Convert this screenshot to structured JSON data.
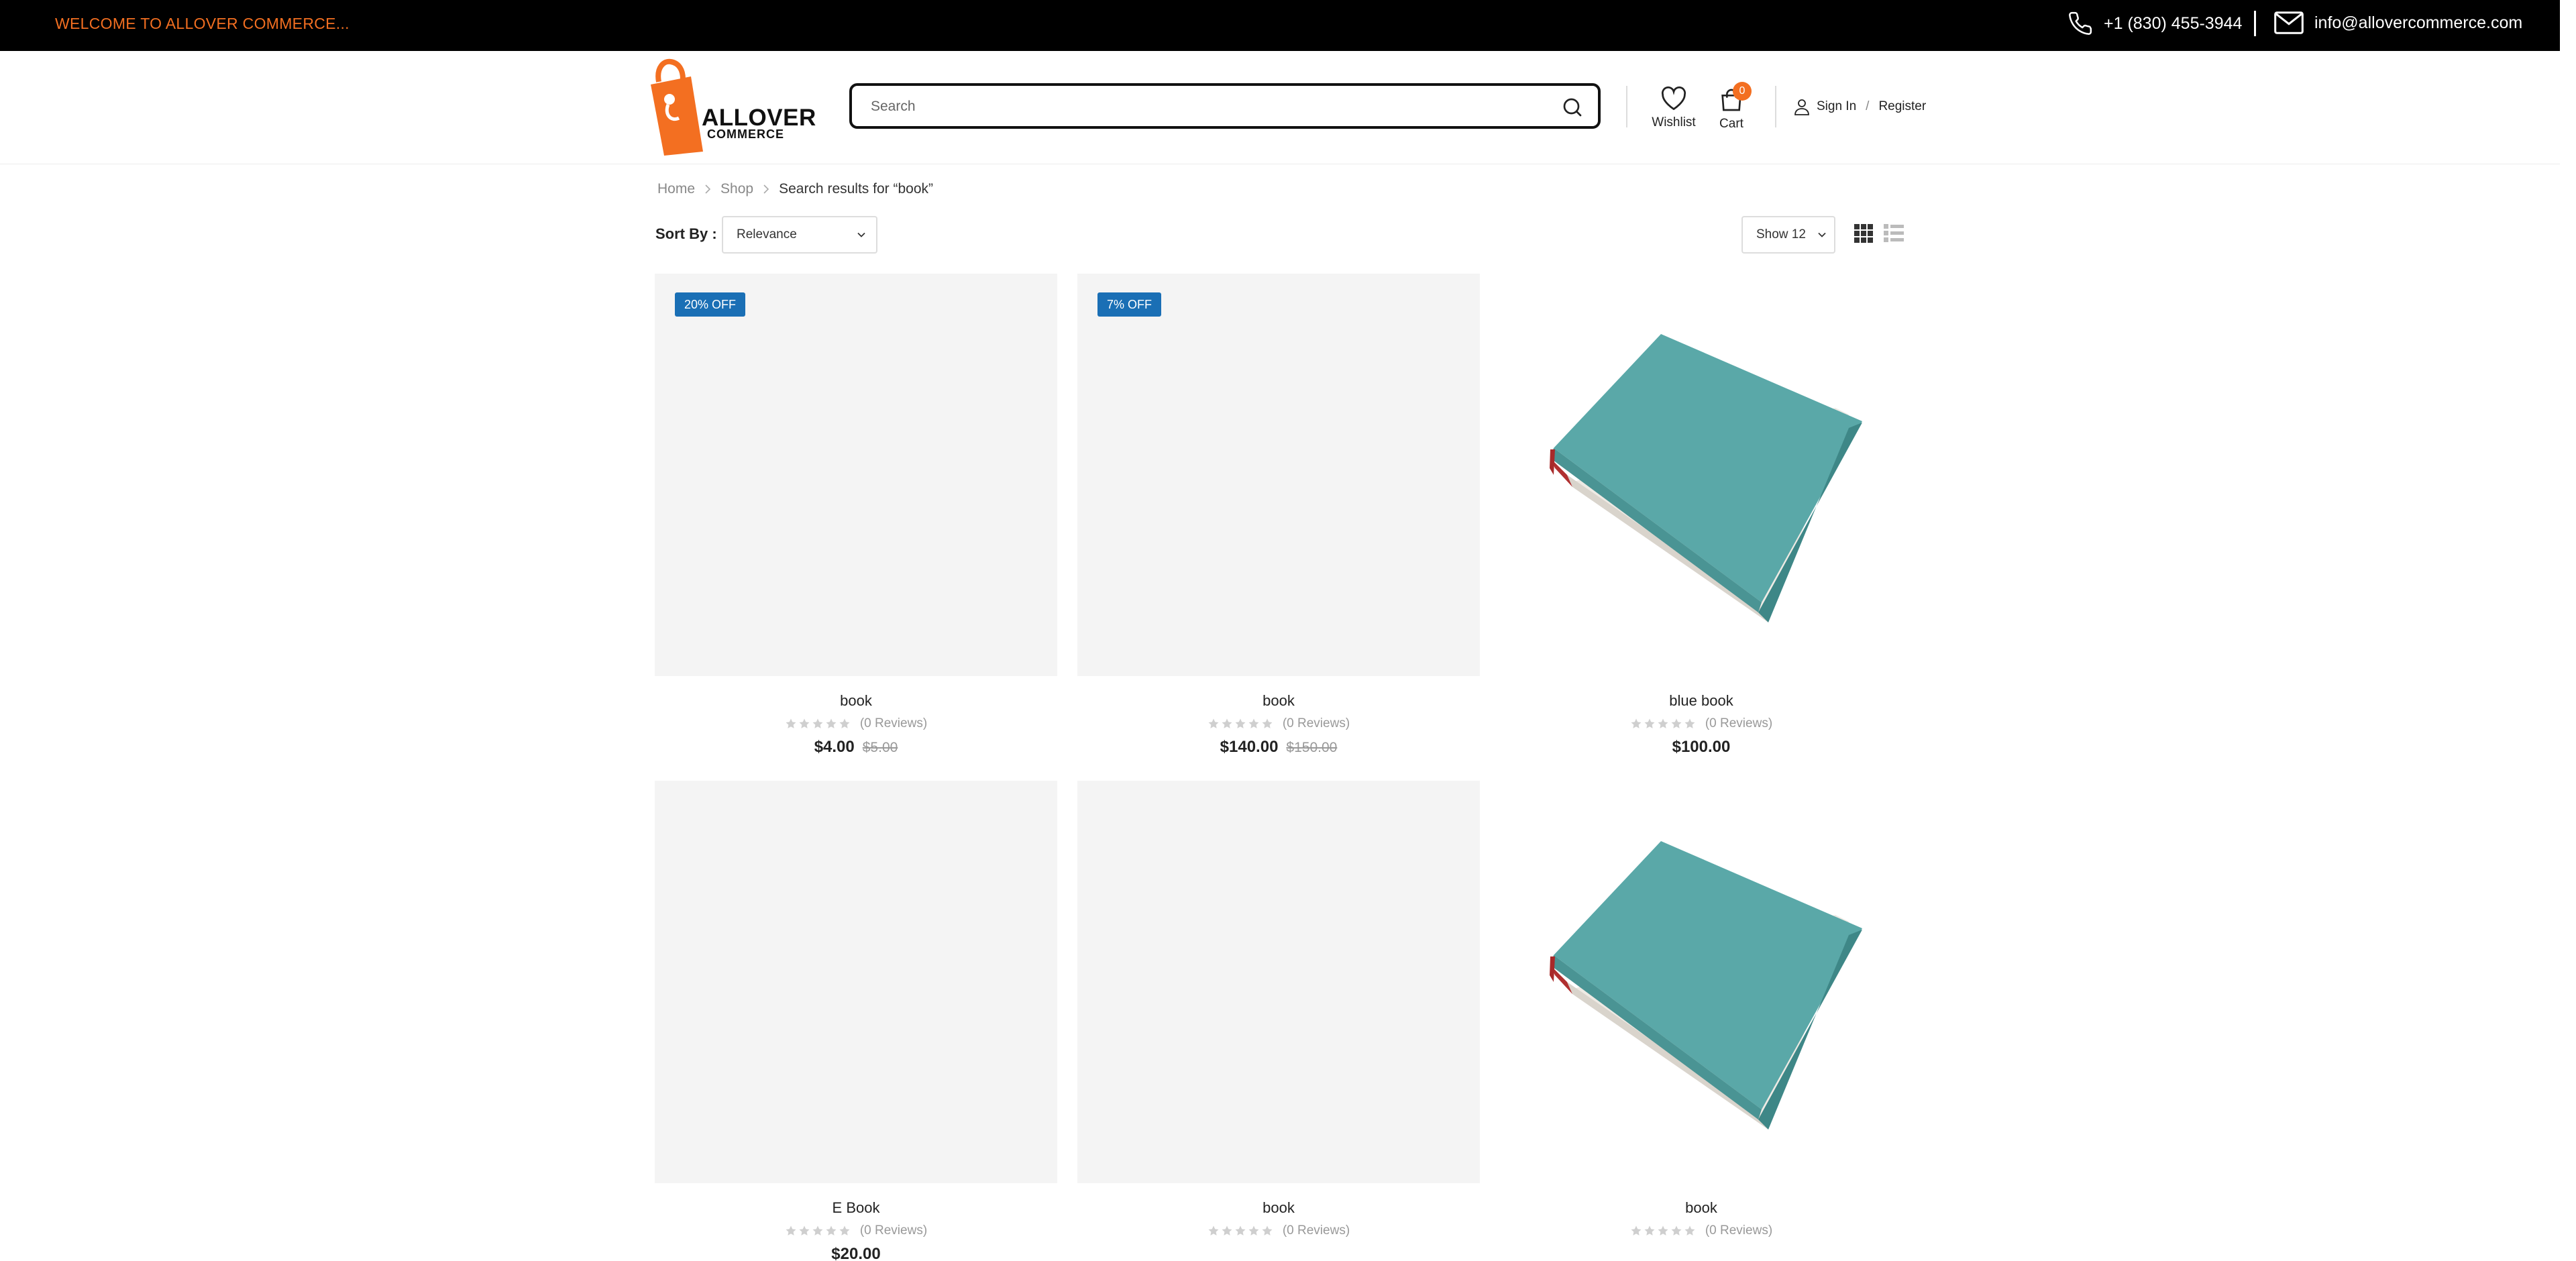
{
  "topbar": {
    "welcome": "WELCOME TO ALLOVER COMMERCE...",
    "phone": "+1 (830) 455-3944",
    "email": "info@allovercommerce.com"
  },
  "header": {
    "logo_line1": "ALLOVER",
    "logo_line2": "COMMERCE",
    "search_placeholder": "Search",
    "wishlist_label": "Wishlist",
    "cart_label": "Cart",
    "cart_count": "0",
    "sign_in": "Sign In",
    "slash": "/",
    "register": "Register"
  },
  "breadcrumb": {
    "home": "Home",
    "shop": "Shop",
    "current": "Search results for “book”"
  },
  "toolbar": {
    "sort_label": "Sort By :",
    "sort_value": "Relevance",
    "show_value": "Show 12"
  },
  "colors": {
    "brand_orange": "#f36f21",
    "badge_blue": "#1a6fb5",
    "book_teal": "#5aa8a8"
  },
  "products": [
    {
      "name": "book",
      "badge": "20% OFF",
      "reviews": "(0 Reviews)",
      "price": "$4.00",
      "old_price": "$5.00",
      "image": "blank"
    },
    {
      "name": "book",
      "badge": "7% OFF",
      "reviews": "(0 Reviews)",
      "price": "$140.00",
      "old_price": "$150.00",
      "image": "blank"
    },
    {
      "name": "blue book",
      "badge": "",
      "reviews": "(0 Reviews)",
      "price": "$100.00",
      "old_price": "",
      "image": "teal-book"
    },
    {
      "name": "E Book",
      "badge": "",
      "reviews": "(0 Reviews)",
      "price": "$20.00",
      "old_price": "",
      "image": "blank"
    },
    {
      "name": "book",
      "badge": "",
      "reviews": "(0 Reviews)",
      "price": "",
      "old_price": "",
      "image": "blank"
    },
    {
      "name": "book",
      "badge": "",
      "reviews": "(0 Reviews)",
      "price": "",
      "old_price": "",
      "image": "teal-book"
    }
  ]
}
